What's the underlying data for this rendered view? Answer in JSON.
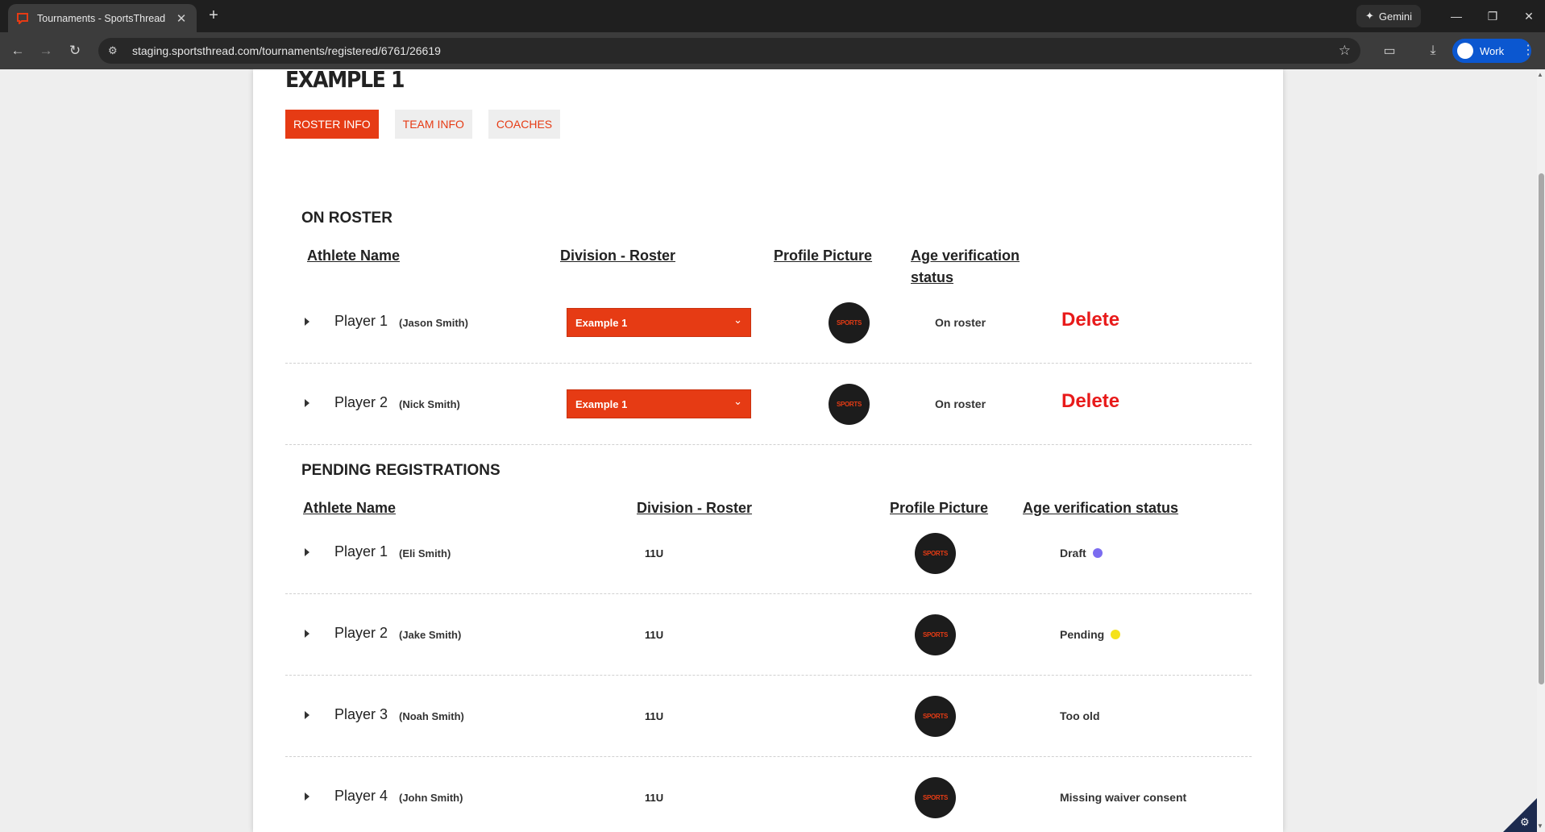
{
  "browser": {
    "tab_title": "Tournaments - SportsThread",
    "tab_close": "✕",
    "new_tab": "+",
    "gemini_label": "Gemini",
    "url": "staging.sportsthread.com/tournaments/registered/6761/26619",
    "profile_label": "Work"
  },
  "page": {
    "team_title": "EXAMPLE 1",
    "tabs": [
      {
        "label": "ROSTER INFO",
        "active": true
      },
      {
        "label": "TEAM INFO",
        "active": false
      },
      {
        "label": "COACHES",
        "active": false
      }
    ]
  },
  "on_roster": {
    "title": "ON ROSTER",
    "headers": {
      "athlete_name": "Athlete Name",
      "division": "Division - Roster",
      "profile_picture": "Profile Picture",
      "age_verification": "Age verification status"
    },
    "rows": [
      {
        "player": "Player 1",
        "name": "(Jason Smith)",
        "division": "Example 1",
        "logo": "SPORTS",
        "status": "On roster",
        "action": "Delete"
      },
      {
        "player": "Player 2",
        "name": "(Nick Smith)",
        "division": "Example 1",
        "logo": "SPORTS",
        "status": "On roster",
        "action": "Delete"
      }
    ]
  },
  "pending": {
    "title": "PENDING REGISTRATIONS",
    "headers": {
      "athlete_name": "Athlete Name",
      "division": "Division - Roster",
      "profile_picture": "Profile Picture",
      "age_verification": "Age verification status"
    },
    "rows": [
      {
        "player": "Player 1",
        "name": "(Eli Smith)",
        "division": "11U",
        "logo": "SPORTS",
        "status": "Draft",
        "status_color": "#7b6cf0"
      },
      {
        "player": "Player 2",
        "name": "(Jake Smith)",
        "division": "11U",
        "logo": "SPORTS",
        "status": "Pending",
        "status_color": "#f5e21b"
      },
      {
        "player": "Player 3",
        "name": "(Noah Smith)",
        "division": "11U",
        "logo": "SPORTS",
        "status": "Too old",
        "status_color": ""
      },
      {
        "player": "Player 4",
        "name": "(John Smith)",
        "division": "11U",
        "logo": "SPORTS",
        "status": "Missing waiver consent",
        "status_color": ""
      }
    ]
  },
  "colors": {
    "brand_orange": "#e63b14",
    "delete_red": "#e81a1a"
  }
}
